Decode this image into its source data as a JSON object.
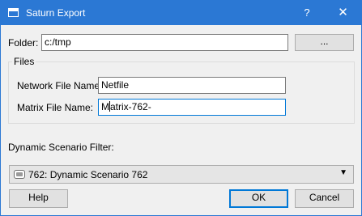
{
  "window": {
    "title": "Saturn Export",
    "help_label": "?",
    "close_label": "✕"
  },
  "folder": {
    "label": "Folder:",
    "value": "c:/tmp",
    "browse_label": "..."
  },
  "files": {
    "group_title": "Files",
    "network_label": "Network File Name:",
    "network_value": "Netfile",
    "matrix_label": "Matrix File Name:",
    "matrix_value_before_caret": "M",
    "matrix_value_after_caret": "atrix-762-"
  },
  "scenario": {
    "label": "Dynamic Scenario Filter:",
    "selected": "762: Dynamic Scenario 762",
    "icon": "scenario-icon"
  },
  "buttons": {
    "help": "Help",
    "ok": "OK",
    "cancel": "Cancel"
  },
  "colors": {
    "title_bar": "#2b78d4",
    "focus_border": "#0078d7",
    "dialog_bg": "#f0f0f0"
  }
}
